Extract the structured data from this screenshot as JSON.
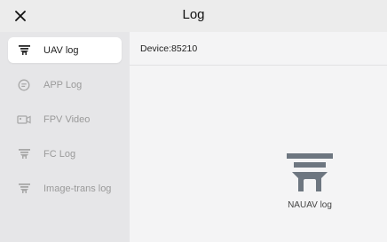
{
  "header": {
    "title": "Log",
    "close_icon": "close-icon"
  },
  "sidebar": {
    "items": [
      {
        "label": "UAV log",
        "icon": "drone-icon",
        "active": true
      },
      {
        "label": "APP Log",
        "icon": "chat-icon",
        "active": false
      },
      {
        "label": "FPV Video",
        "icon": "camera-icon",
        "active": false
      },
      {
        "label": "FC Log",
        "icon": "drone-icon",
        "active": false
      },
      {
        "label": "Image-trans log",
        "icon": "drone-icon",
        "active": false
      }
    ]
  },
  "main": {
    "device_label": "Device:85210",
    "entries": [
      {
        "label": "NAUAV log",
        "icon": "drone-icon"
      }
    ]
  },
  "colors": {
    "background": "#ececec",
    "sidebar": "#e6e6e8",
    "content": "#f4f4f5",
    "active_item": "#ffffff",
    "icon_gray": "#6d7680"
  }
}
